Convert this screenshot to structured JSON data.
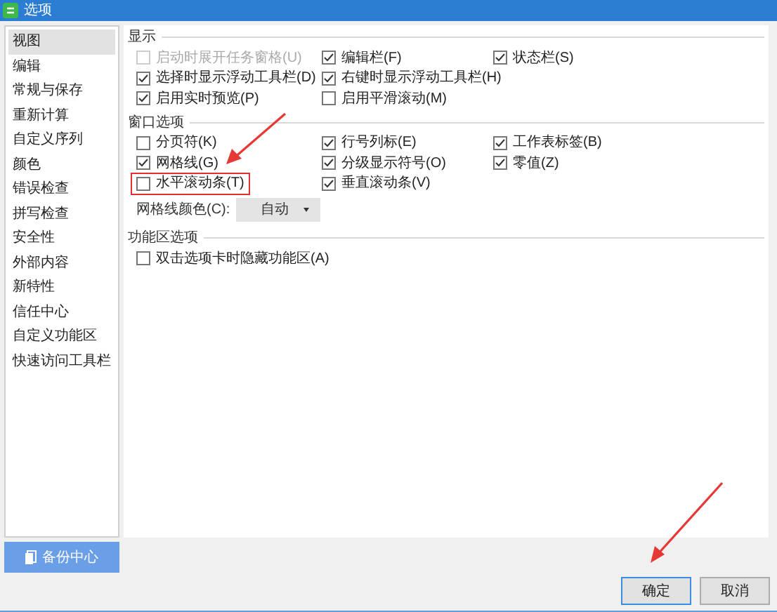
{
  "window": {
    "title": "选项"
  },
  "sidebar": {
    "items": [
      {
        "label": "视图",
        "selected": true
      },
      {
        "label": "编辑",
        "selected": false
      },
      {
        "label": "常规与保存",
        "selected": false
      },
      {
        "label": "重新计算",
        "selected": false
      },
      {
        "label": "自定义序列",
        "selected": false
      },
      {
        "label": "颜色",
        "selected": false
      },
      {
        "label": "错误检查",
        "selected": false
      },
      {
        "label": "拼写检查",
        "selected": false
      },
      {
        "label": "安全性",
        "selected": false
      },
      {
        "label": "外部内容",
        "selected": false
      },
      {
        "label": "新特性",
        "selected": false
      },
      {
        "label": "信任中心",
        "selected": false
      },
      {
        "label": "自定义功能区",
        "selected": false
      },
      {
        "label": "快速访问工具栏",
        "selected": false
      }
    ]
  },
  "sections": [
    {
      "title": "显示",
      "rows": [
        [
          {
            "label": "启动时展开任务窗格(U)",
            "checked": false,
            "disabled": true,
            "highlighted": false
          },
          {
            "label": "编辑栏(F)",
            "checked": true,
            "disabled": false,
            "highlighted": false
          },
          {
            "label": "状态栏(S)",
            "checked": true,
            "disabled": false,
            "highlighted": false
          }
        ],
        [
          {
            "label": "选择时显示浮动工具栏(D)",
            "checked": true,
            "disabled": false,
            "highlighted": false
          },
          {
            "label": "右键时显示浮动工具栏(H)",
            "checked": true,
            "disabled": false,
            "highlighted": false
          }
        ],
        [
          {
            "label": "启用实时预览(P)",
            "checked": true,
            "disabled": false,
            "highlighted": false
          },
          {
            "label": "启用平滑滚动(M)",
            "checked": false,
            "disabled": false,
            "highlighted": false
          }
        ]
      ]
    },
    {
      "title": "窗口选项",
      "rows": [
        [
          {
            "label": "分页符(K)",
            "checked": false,
            "disabled": false,
            "highlighted": false
          },
          {
            "label": "行号列标(E)",
            "checked": true,
            "disabled": false,
            "highlighted": false
          },
          {
            "label": "工作表标签(B)",
            "checked": true,
            "disabled": false,
            "highlighted": false
          }
        ],
        [
          {
            "label": "网格线(G)",
            "checked": true,
            "disabled": false,
            "highlighted": false
          },
          {
            "label": "分级显示符号(O)",
            "checked": true,
            "disabled": false,
            "highlighted": false
          },
          {
            "label": "零值(Z)",
            "checked": true,
            "disabled": false,
            "highlighted": false
          }
        ],
        [
          {
            "label": "水平滚动条(T)",
            "checked": false,
            "disabled": false,
            "highlighted": true
          },
          {
            "label": "垂直滚动条(V)",
            "checked": true,
            "disabled": false,
            "highlighted": false
          }
        ]
      ],
      "dropdown": {
        "label": "网格线颜色(C):",
        "value": "自动"
      }
    },
    {
      "title": "功能区选项",
      "rows": [
        [
          {
            "label": "双击选项卡时隐藏功能区(A)",
            "checked": false,
            "disabled": false,
            "highlighted": false
          }
        ]
      ]
    }
  ],
  "backup_button": "备份中心",
  "buttons": [
    {
      "label": "确定",
      "selected": true
    },
    {
      "label": "取消",
      "selected": false
    }
  ]
}
